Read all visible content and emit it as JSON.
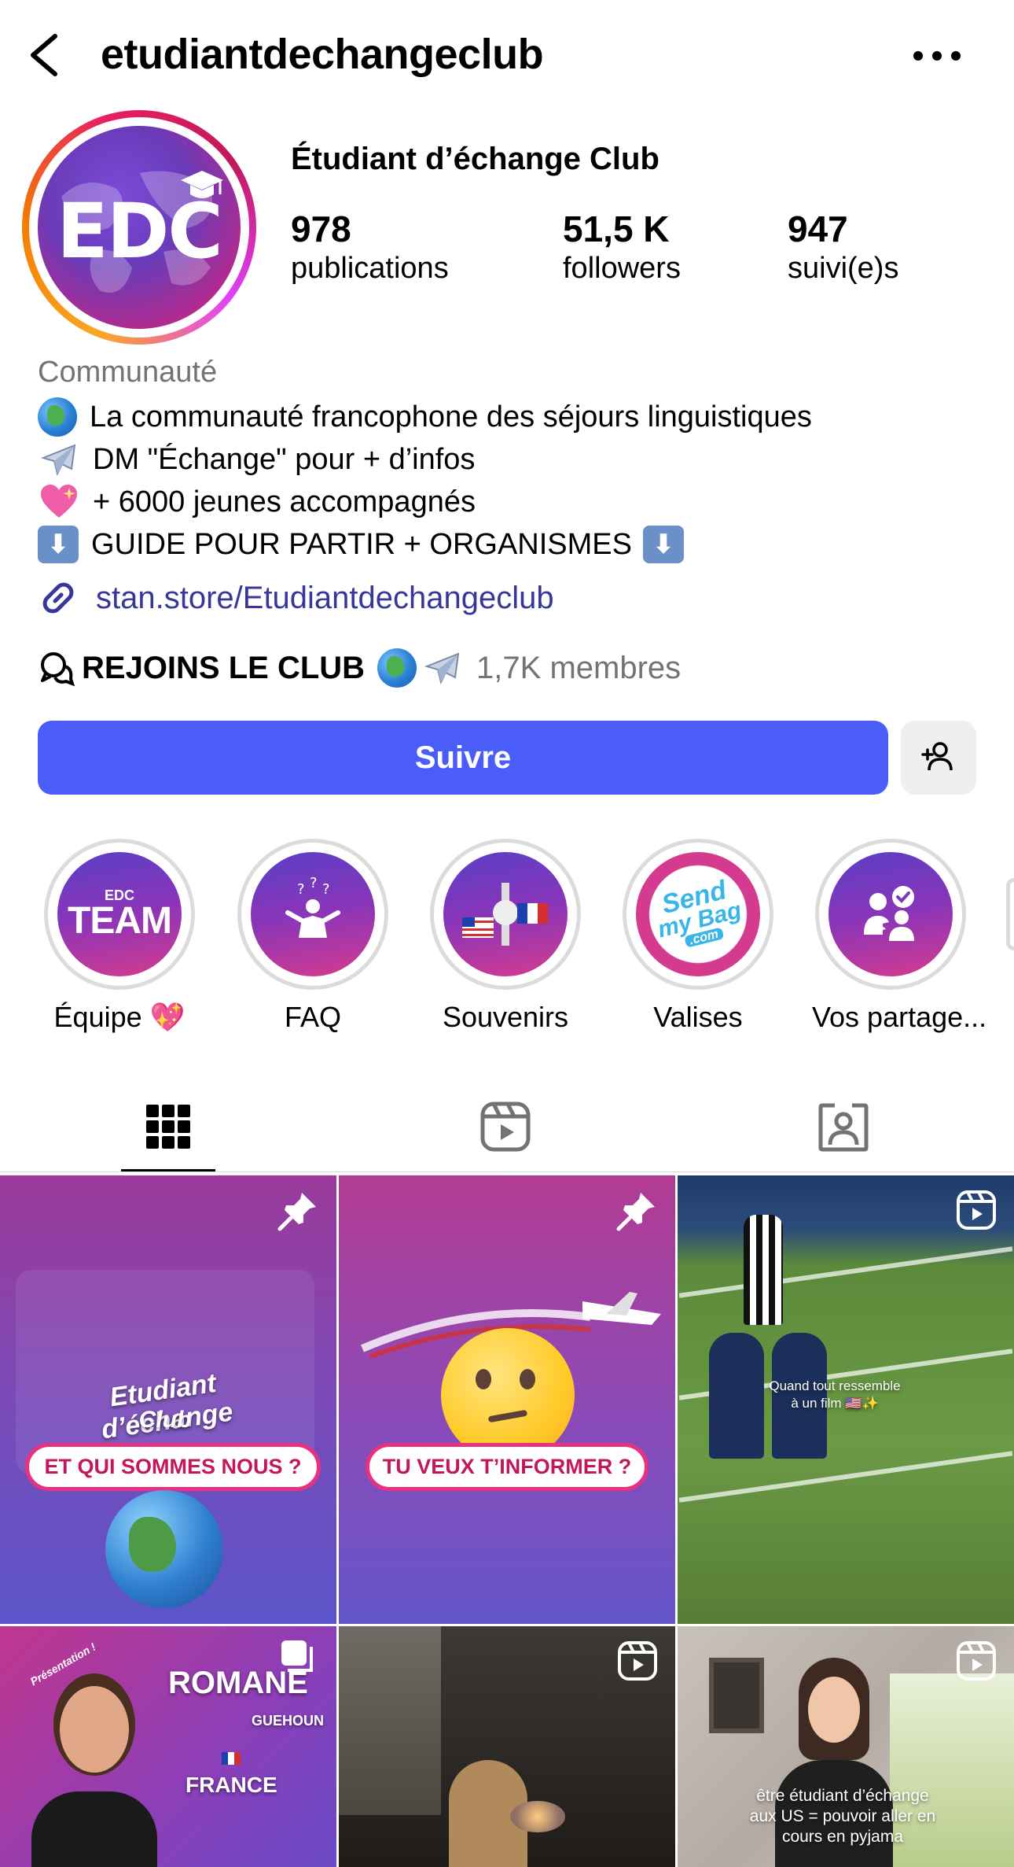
{
  "header": {
    "handle": "etudiantdechangeclub",
    "back_icon": "chevron-left-icon",
    "more_icon": "more-horizontal-icon"
  },
  "profile": {
    "avatar_text": "EDC",
    "display_name": "Étudiant d’échange Club",
    "stats": [
      {
        "value": "978",
        "label": "publications"
      },
      {
        "value": "51,5 K",
        "label": "followers"
      },
      {
        "value": "947",
        "label": "suivi(e)s"
      }
    ],
    "category": "Communauté",
    "bio": [
      {
        "icon": "globe-emoji",
        "text": "La communauté francophone des séjours linguistiques"
      },
      {
        "icon": "airplane-emoji",
        "text": "DM \"Échange\" pour + d’infos"
      },
      {
        "icon": "sparkling-heart-emoji",
        "text": "+ 6000 jeunes accompagnés"
      },
      {
        "icon": "down-arrow-emoji",
        "text": "GUIDE POUR PARTIR + ORGANISMES",
        "trailing_icon": "down-arrow-emoji"
      }
    ],
    "link": "stan.store/Etudiantdechangeclub",
    "channel": {
      "name": "REJOINS LE CLUB",
      "members": "1,7K membres"
    }
  },
  "actions": {
    "follow_label": "Suivre",
    "add_user_icon": "add-user-icon"
  },
  "highlights": [
    {
      "label": "Équipe 💖",
      "cover_small": "EDC",
      "cover_big": "TEAM"
    },
    {
      "label": "FAQ"
    },
    {
      "label": "Souvenirs"
    },
    {
      "label": "Valises",
      "cover_line1": "Send",
      "cover_line2": "my Bag",
      "cover_line3": ".com"
    },
    {
      "label": "Vos partage..."
    }
  ],
  "tabs": [
    {
      "name": "grid",
      "icon": "grid-icon",
      "active": true
    },
    {
      "name": "reels",
      "icon": "reels-icon",
      "active": false
    },
    {
      "name": "tagged",
      "icon": "tagged-icon",
      "active": false
    }
  ],
  "posts": [
    {
      "type": "pinned",
      "title": "Etudiant d’échange",
      "subtitle": "Club",
      "pill": "ET QUI SOMMES NOUS ?"
    },
    {
      "type": "pinned",
      "pill": "TU VEUX T’INFORMER ?"
    },
    {
      "type": "reel",
      "caption_1": "Quand tout ressemble",
      "caption_2": "à un film 🇺🇸✨"
    },
    {
      "type": "carousel",
      "tag": "Présentation !",
      "name": "ROMANE",
      "place": "GUEHOUN",
      "country": "FRANCE"
    },
    {
      "type": "reel"
    },
    {
      "type": "reel",
      "caption_1": "être étudiant d’échange",
      "caption_2": "aux US = pouvoir aller en",
      "caption_3": "cours en pyjama"
    }
  ],
  "colors": {
    "follow": "#4a5df9",
    "link": "#37379a",
    "muted": "#737373",
    "brand_purple": "#6a3bb8",
    "brand_pink": "#d4358f"
  }
}
